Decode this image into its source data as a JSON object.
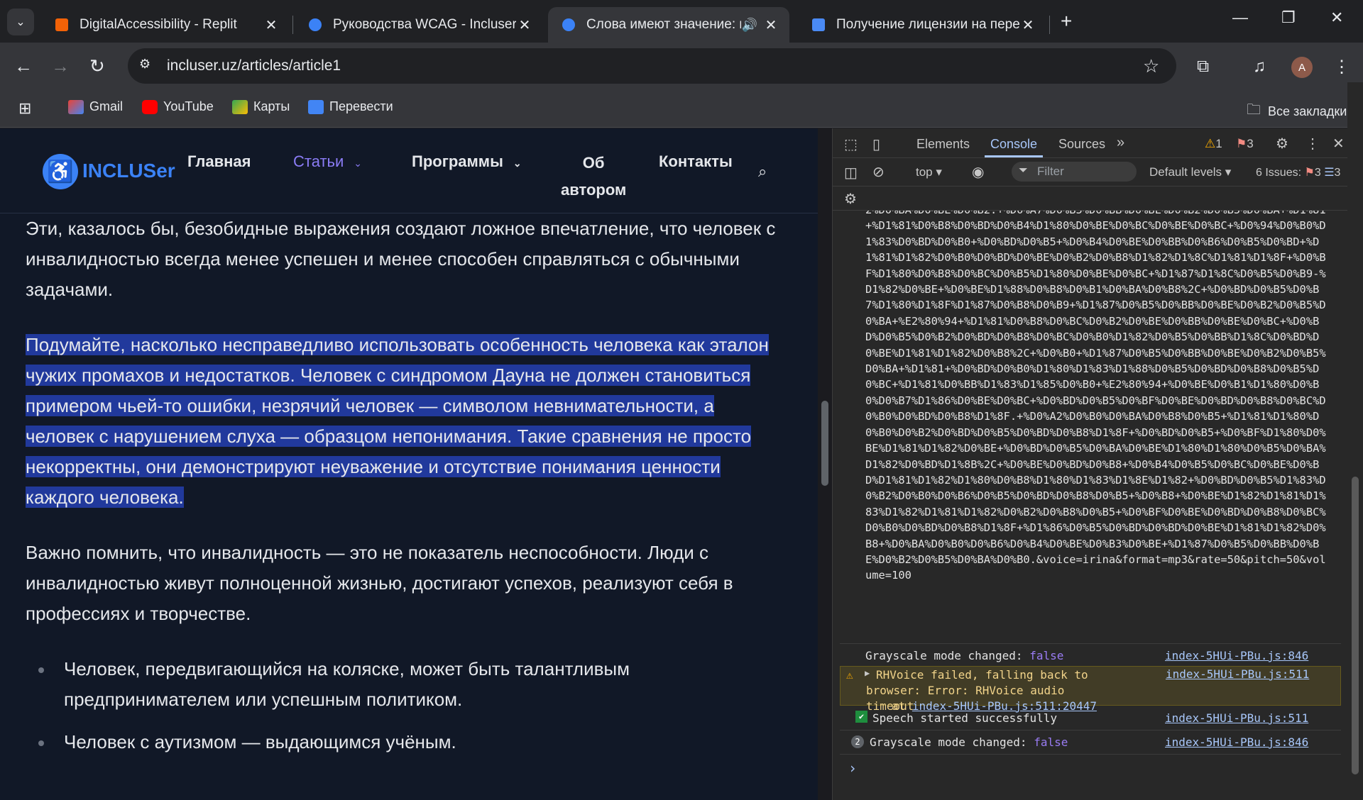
{
  "browser": {
    "tabs": [
      {
        "title": "DigitalAccessibility - Replit",
        "active": false
      },
      {
        "title": "Руководства WCAG - Incluser",
        "active": false
      },
      {
        "title": "Слова имеют значение: ка",
        "active": true
      },
      {
        "title": "Получение лицензии на перег",
        "active": false
      }
    ],
    "url": "incluser.uz/articles/article1",
    "avatar_letter": "A",
    "bookmarks": [
      "Gmail",
      "YouTube",
      "Карты",
      "Перевести"
    ],
    "all_bookmarks": "Все закладки"
  },
  "site": {
    "logo_text": "INCLUSer",
    "nav": {
      "home": "Главная",
      "articles": "Статьи",
      "programs": "Программы",
      "about_line1": "Об",
      "about_line2": "автором",
      "contacts": "Контакты"
    }
  },
  "article": {
    "p1": "Эти, казалось бы, безобидные выражения создают ложное впечатление, что человек с инвалидностью всегда менее успешен и менее способен справляться с обычными задачами.",
    "p2_lines": [
      "Подумайте, насколько несправедливо использовать особенность человека как эталон",
      "чужих промахов и недостатков. Человек с синдромом Дауна не должен становиться",
      "примером чьей-то ошибки, незрячий человек — символом невнимательности, а",
      "человек с нарушением слуха — образцом непонимания. Такие сравнения не просто",
      "некорректны, они демонстрируют неуважение и отсутствие понимания ценности",
      "каждого человека."
    ],
    "p3": "Важно помнить, что инвалидность — это не показатель неспособности. Люди с инвалидностью живут полноценной жизнью, достигают успехов, реализуют себя в профессиях и творчестве.",
    "list": [
      "Человек, передвигающийся на коляске, может быть талантливым предпринимателем или успешным политиком.",
      "Человек с аутизмом — выдающимся учёным."
    ]
  },
  "devtools": {
    "tabs": [
      "Elements",
      "Console",
      "Sources"
    ],
    "active_tab": "Console",
    "warn_count": "1",
    "err_count": "3",
    "context": "top",
    "filter_placeholder": "Filter",
    "levels": "Default levels",
    "issues_label": "6 Issues:",
    "issues_err": "3",
    "issues_info": "3",
    "url_log": "2%D0%BA%D0%BE%D0%B2.+%D0%A7%D0%B5%D0%BB%D0%BE%D0%B2%D0%B5%D0%BA+%D1%81+%D1%81%D0%B8%D0%BD%D0%B4%D1%80%D0%BE%D0%BC%D0%BE%D0%BC+%D0%94%D0%B0%D1%83%D0%BD%D0%B0+%D0%BD%D0%B5+%D0%B4%D0%BE%D0%BB%D0%B6%D0%B5%D0%BD+%D1%81%D1%82%D0%B0%D0%BD%D0%BE%D0%B2%D0%B8%D1%82%D1%8C%D1%81%D1%8F+%D0%BF%D1%80%D0%B8%D0%BC%D0%B5%D1%80%D0%BE%D0%BC+%D1%87%D1%8C%D0%B5%D0%B9-%D1%82%D0%BE+%D0%BE%D1%88%D0%B8%D0%B1%D0%BA%D0%B8%2C+%D0%BD%D0%B5%D0%B7%D1%80%D1%8F%D1%87%D0%B8%D0%B9+%D1%87%D0%B5%D0%BB%D0%BE%D0%B2%D0%B5%D0%BA+%E2%80%94+%D1%81%D0%B8%D0%BC%D0%B2%D0%BE%D0%BB%D0%BE%D0%BC+%D0%BD%D0%B5%D0%B2%D0%BD%D0%B8%D0%BC%D0%B0%D1%82%D0%B5%D0%BB%D1%8C%D0%BD%D0%BE%D1%81%D1%82%D0%B8%2C+%D0%B0+%D1%87%D0%B5%D0%BB%D0%BE%D0%B2%D0%B5%D0%BA+%D1%81+%D0%BD%D0%B0%D1%80%D1%83%D1%88%D0%B5%D0%BD%D0%B8%D0%B5%D0%BC+%D1%81%D0%BB%D1%83%D1%85%D0%B0+%E2%80%94+%D0%BE%D0%B1%D1%80%D0%B0%D0%B7%D1%86%D0%BE%D0%BC+%D0%BD%D0%B5%D0%BF%D0%BE%D0%BD%D0%B8%D0%BC%D0%B0%D0%BD%D0%B8%D1%8F.+%D0%A2%D0%B0%D0%BA%D0%B8%D0%B5+%D1%81%D1%80%D0%B0%D0%B2%D0%BD%D0%B5%D0%BD%D0%B8%D1%8F+%D0%BD%D0%B5+%D0%BF%D1%80%D0%BE%D1%81%D1%82%D0%BE+%D0%BD%D0%B5%D0%BA%D0%BE%D1%80%D1%80%D0%B5%D0%BA%D1%82%D0%BD%D1%8B%2C+%D0%BE%D0%BD%D0%B8+%D0%B4%D0%B5%D0%BC%D0%BE%D0%BD%D1%81%D1%82%D1%80%D0%B8%D1%80%D1%83%D1%8E%D1%82+%D0%BD%D0%B5%D1%83%D0%B2%D0%B0%D0%B6%D0%B5%D0%BD%D0%B8%D0%B5+%D0%B8+%D0%BE%D1%82%D1%81%D1%83%D1%82%D1%81%D1%82%D0%B2%D0%B8%D0%B5+%D0%BF%D0%BE%D0%BD%D0%B8%D0%BC%D0%B0%D0%BD%D0%B8%D1%8F+%D1%86%D0%B5%D0%BD%D0%BD%D0%BE%D1%81%D1%82%D0%B8+%D0%BA%D0%B0%D0%B6%D0%B4%D0%BE%D0%B3%D0%BE+%D1%87%D0%B5%D0%BB%D0%BE%D0%B2%D0%B5%D0%BA%D0%B0.&voice=irina&format=mp3&rate=50&pitch=50&volume=100",
    "logs": [
      {
        "text": "Grayscale mode changed: ",
        "value": "false",
        "source": "index-5HUi-PBu.js:846"
      },
      {
        "text": "RHVoice failed, falling back to browser: Error: RHVoice audio timeout",
        "at": "at ",
        "link": "index-5HUi-PBu.js:511:20447",
        "source": "index-5HUi-PBu.js:511"
      },
      {
        "text": "Speech started successfully",
        "source": "index-5HUi-PBu.js:511"
      },
      {
        "count": "2",
        "text": "Grayscale mode changed: ",
        "value": "false",
        "source": "index-5HUi-PBu.js:846"
      }
    ],
    "prompt": "›"
  }
}
